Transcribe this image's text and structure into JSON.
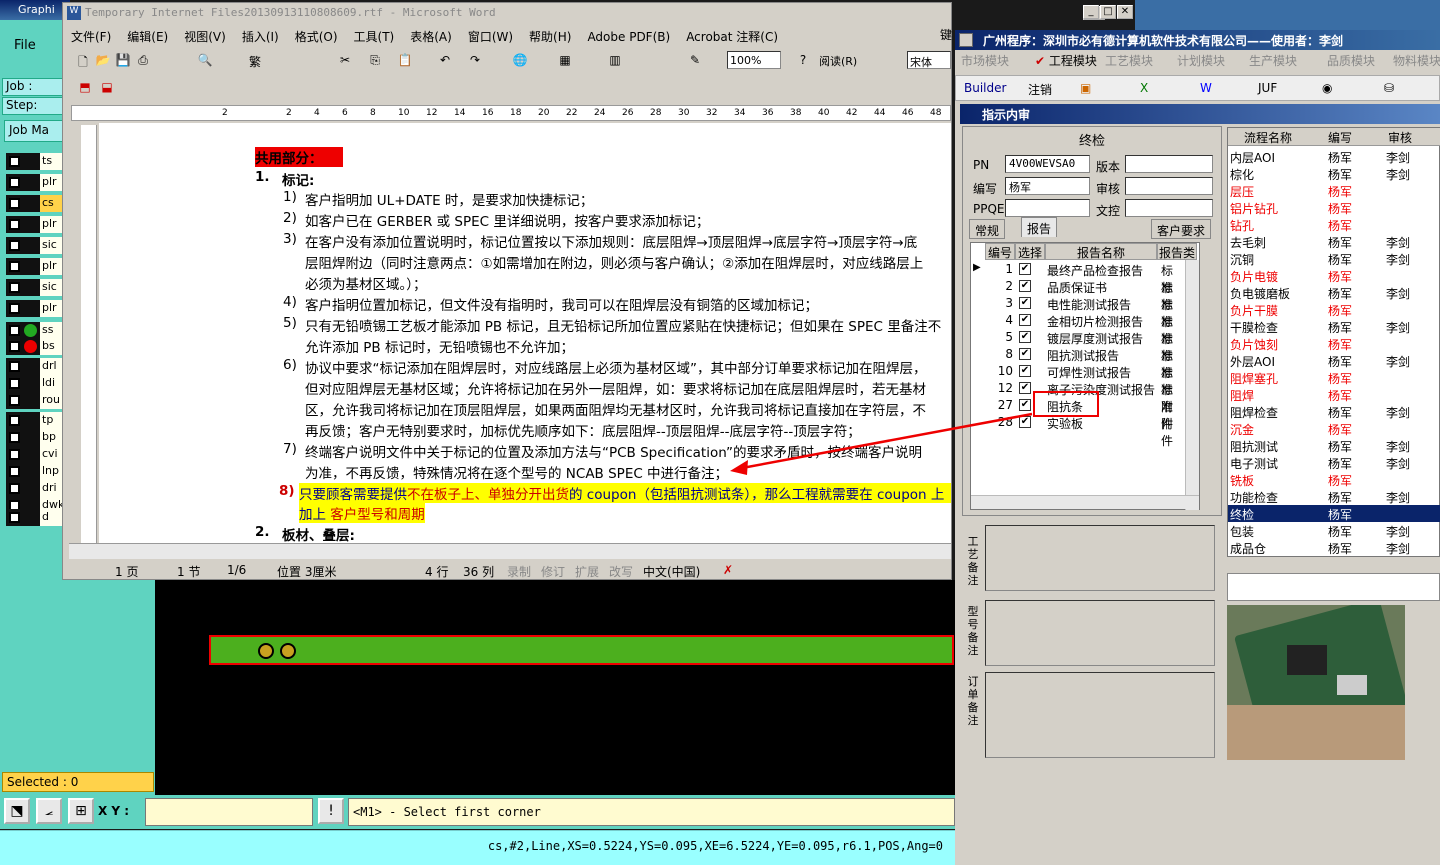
{
  "cam": {
    "title": "Graphi",
    "file_menu": "File",
    "job_label": "Job :",
    "step_label": "Step:",
    "job_manager": "Job Ma",
    "layers": [
      "ts",
      "plr",
      "cs",
      "plr",
      "sic",
      "plr",
      "sic",
      "plr",
      "ss",
      "bs",
      "drl",
      "ldi",
      "rou",
      "tp",
      "bp",
      "cvi",
      "lnp",
      "dri",
      "dwk",
      "d"
    ],
    "selected": "Selected : 0",
    "xy_label": "X Y :",
    "message": "<M1> - Select first corner",
    "status_line": "cs,#2,Line,XS=0.5224,YS=0.095,XE=6.5224,YE=0.095,r6.1,POS,Ang=0"
  },
  "word": {
    "title": "Temporary Internet Files20130913110808609.rtf - Microsoft Word",
    "menu": [
      "文件(F)",
      "编辑(E)",
      "视图(V)",
      "插入(I)",
      "格式(O)",
      "工具(T)",
      "表格(A)",
      "窗口(W)",
      "帮助(H)",
      "Adobe PDF(B)",
      "Acrobat 注释(C)"
    ],
    "zoom": "100%",
    "reading_button": "阅读(R)",
    "font_name": "宋体",
    "ruler_marks": [
      "2",
      "2",
      "4",
      "6",
      "8",
      "10",
      "12",
      "14",
      "16",
      "18",
      "20",
      "22",
      "24",
      "26",
      "28",
      "30",
      "32",
      "34",
      "36",
      "38",
      "40",
      "42",
      "44",
      "46",
      "48"
    ],
    "doc": {
      "section_title": "共用部分：",
      "h1_num": "1.",
      "h1": "标记:",
      "items": [
        {
          "n": "1)",
          "lines": [
            "客户指明加 UL+DATE 时，是要求加快捷标记；"
          ]
        },
        {
          "n": "2)",
          "lines": [
            "如客户已在 GERBER 或 SPEC 里详细说明，按客户要求添加标记；"
          ]
        },
        {
          "n": "3)",
          "lines": [
            "在客户没有添加位置说明时，标记位置按以下添加规则：底层阻焊→顶层阻焊→底层字符→顶层字符→底",
            "层阻焊附边（同时注意两点：①如需增加在附边，则必须与客户确认；②添加在阻焊层时，对应线路层上",
            "必须为基材区域。）；"
          ]
        },
        {
          "n": "4)",
          "lines": [
            "客户指明位置加标记，但文件没有指明时，我司可以在阻焊层没有铜箔的区域加标记；"
          ]
        },
        {
          "n": "5)",
          "lines": [
            "只有无铅喷锡工艺板才能添加 PB 标记，且无铅标记所加位置应紧贴在快捷标记；但如果在 SPEC 里备注不",
            "允许添加 PB 标记时，无铅喷锡也不允许加；"
          ]
        },
        {
          "n": "6)",
          "lines": [
            "协议中要求“标记添加在阻焊层时，对应线路层上必须为基材区域”，其中部分订单要求标记加在阻焊层，",
            "但对应阻焊层无基材区域；允许将标记加在另外一层阻焊，如：要求将标记加在底层阻焊层时，若无基材",
            "区，允许我司将标记加在顶层阻焊层，如果两面阻焊均无基材区时，允许我司将标记直接加在字符层，不",
            "再反馈；客户无特别要求时，加标优先顺序如下：底层阻焊--顶层阻焊--底层字符--顶层字符；"
          ]
        },
        {
          "n": "7)",
          "lines": [
            "终端客户说明文件中关于标记的位置及添加方法与“PCB Specification”的要求矛盾时，按终端客户说明",
            "为准，不再反馈，特殊情况将在逐个型号的 NCAB SPEC 中进行备注；"
          ]
        }
      ],
      "item8_num": "8)",
      "item8_a": "只要顾客需要提供",
      "item8_b": "不在板子上、单独分开出货",
      "item8_c": "的 coupon（包括阻抗测试条），那么工程就需要在 coupon 上",
      "item8_d": "加上",
      "item8_e": "客户型号和周期",
      "h2_num": "2.",
      "h2": "板材、叠层:"
    },
    "status": {
      "page": "1 页",
      "section": "1 节",
      "pages": "1/6",
      "position": "位置 3厘米",
      "line": "4 行",
      "column": "36 列",
      "rec": "录制",
      "trk": "修订",
      "ext": "扩展",
      "ovr": "改写",
      "lang": "中文(中国)"
    }
  },
  "erp": {
    "title": "广州程序：深圳市必有德计算机软件技术有限公司——使用者：李剑",
    "modules": [
      "市场模块",
      "工程模块",
      "工艺模块",
      "计划模块",
      "生产模块",
      "品质模块",
      "物料模块",
      "维修模"
    ],
    "tools": [
      "Builder",
      "注销",
      "JUF"
    ],
    "subtitle": "指示内审",
    "panel_title": "终检",
    "fields": {
      "pn_label": "PN",
      "pn_value": "4V00WEVSA0",
      "version_label": "版本",
      "version_value": "",
      "code_label": "编写",
      "code_value": "杨军",
      "review_label": "审核",
      "review_value": "",
      "ppqe_label": "PPQE",
      "ppqe_value": "",
      "control_label": "文控",
      "control_value": ""
    },
    "tabs": [
      "常规",
      "报告",
      "客户要求"
    ],
    "report_headers": [
      "编号",
      "选择",
      "报告名称",
      "报告类"
    ],
    "reports": [
      {
        "id": "1",
        "name": "最终产品检查报告",
        "type": "标准"
      },
      {
        "id": "2",
        "name": "品质保证书",
        "type": "标准"
      },
      {
        "id": "3",
        "name": "电性能测试报告",
        "type": "标准"
      },
      {
        "id": "4",
        "name": "金相切片检测报告",
        "type": "标准"
      },
      {
        "id": "5",
        "name": "镀层厚度测试报告",
        "type": "标准"
      },
      {
        "id": "8",
        "name": "阻抗测试报告",
        "type": "标准"
      },
      {
        "id": "10",
        "name": "可焊性测试报告",
        "type": "标准"
      },
      {
        "id": "12",
        "name": "离子污染度测试报告",
        "type": "标准"
      },
      {
        "id": "27",
        "name": "阻抗条",
        "type": "附件"
      },
      {
        "id": "28",
        "name": "实验板",
        "type": "附件"
      }
    ],
    "process_headers": [
      "流程名称",
      "编写",
      "审核"
    ],
    "processes": [
      {
        "name": "内层AOI",
        "w": "杨军",
        "r": "李剑",
        "red": false
      },
      {
        "name": "棕化",
        "w": "杨军",
        "r": "李剑",
        "red": false
      },
      {
        "name": "层压",
        "w": "杨军",
        "r": "",
        "red": true
      },
      {
        "name": "铝片钻孔",
        "w": "杨军",
        "r": "",
        "red": true
      },
      {
        "name": "钻孔",
        "w": "杨军",
        "r": "",
        "red": true
      },
      {
        "name": "去毛刺",
        "w": "杨军",
        "r": "李剑",
        "red": false
      },
      {
        "name": "沉铜",
        "w": "杨军",
        "r": "李剑",
        "red": false
      },
      {
        "name": "负片电镀",
        "w": "杨军",
        "r": "",
        "red": true
      },
      {
        "name": "负电镀磨板",
        "w": "杨军",
        "r": "李剑",
        "red": false
      },
      {
        "name": "负片干膜",
        "w": "杨军",
        "r": "",
        "red": true
      },
      {
        "name": "干膜检查",
        "w": "杨军",
        "r": "李剑",
        "red": false
      },
      {
        "name": "负片蚀刻",
        "w": "杨军",
        "r": "",
        "red": true
      },
      {
        "name": "外层AOI",
        "w": "杨军",
        "r": "李剑",
        "red": false
      },
      {
        "name": "阻焊塞孔",
        "w": "杨军",
        "r": "",
        "red": true
      },
      {
        "name": "阻焊",
        "w": "杨军",
        "r": "",
        "red": true
      },
      {
        "name": "阻焊检查",
        "w": "杨军",
        "r": "李剑",
        "red": false
      },
      {
        "name": "沉金",
        "w": "杨军",
        "r": "",
        "red": true
      },
      {
        "name": "阻抗测试",
        "w": "杨军",
        "r": "李剑",
        "red": false
      },
      {
        "name": "电子测试",
        "w": "杨军",
        "r": "李剑",
        "red": false
      },
      {
        "name": "铣板",
        "w": "杨军",
        "r": "",
        "red": true
      },
      {
        "name": "功能检查",
        "w": "杨军",
        "r": "李剑",
        "red": false
      },
      {
        "name": "终检",
        "w": "杨军",
        "r": "",
        "red": true,
        "selected": true
      },
      {
        "name": "包装",
        "w": "杨军",
        "r": "李剑",
        "red": false
      },
      {
        "name": "成品仓",
        "w": "杨军",
        "r": "李剑",
        "red": false
      }
    ],
    "note_labels": [
      "工艺备注",
      "型号备注",
      "订单备注"
    ],
    "keyboard_hint": "键"
  }
}
